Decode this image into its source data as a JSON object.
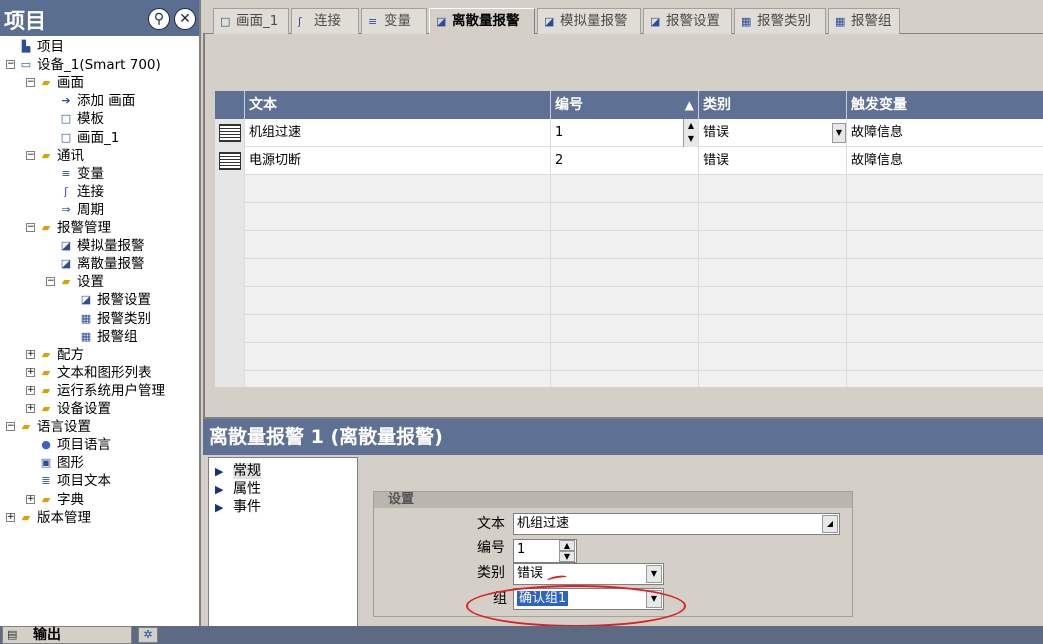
{
  "project": {
    "title": "项目",
    "tree": [
      {
        "label": "项目",
        "icon": "project-icon",
        "level": 0,
        "expander": ""
      },
      {
        "label": "设备_1(Smart 700)",
        "icon": "device-icon",
        "level": 0,
        "expander": "−"
      },
      {
        "label": "画面",
        "icon": "folder-icon",
        "level": 1,
        "expander": "−"
      },
      {
        "label": "添加 画面",
        "icon": "add-screen-icon",
        "level": 2,
        "expander": ""
      },
      {
        "label": "模板",
        "icon": "template-icon",
        "level": 2,
        "expander": ""
      },
      {
        "label": "画面_1",
        "icon": "screen-icon",
        "level": 2,
        "expander": ""
      },
      {
        "label": "通讯",
        "icon": "folder-icon",
        "level": 1,
        "expander": "−"
      },
      {
        "label": "变量",
        "icon": "tags-icon",
        "level": 2,
        "expander": ""
      },
      {
        "label": "连接",
        "icon": "connection-icon",
        "level": 2,
        "expander": ""
      },
      {
        "label": "周期",
        "icon": "cycle-icon",
        "level": 2,
        "expander": ""
      },
      {
        "label": "报警管理",
        "icon": "folder-icon",
        "level": 1,
        "expander": "−"
      },
      {
        "label": "模拟量报警",
        "icon": "analog-alarm-icon",
        "level": 2,
        "expander": ""
      },
      {
        "label": "离散量报警",
        "icon": "discrete-alarm-icon",
        "level": 2,
        "expander": ""
      },
      {
        "label": "设置",
        "icon": "folder-settings-icon",
        "level": 2,
        "expander": "−"
      },
      {
        "label": "报警设置",
        "icon": "alarm-settings-icon",
        "level": 3,
        "expander": ""
      },
      {
        "label": "报警类别",
        "icon": "alarm-classes-icon",
        "level": 3,
        "expander": ""
      },
      {
        "label": "报警组",
        "icon": "alarm-groups-icon",
        "level": 3,
        "expander": ""
      },
      {
        "label": "配方",
        "icon": "folder-icon",
        "level": 1,
        "expander": "+"
      },
      {
        "label": "文本和图形列表",
        "icon": "folder-icon",
        "level": 1,
        "expander": "+"
      },
      {
        "label": "运行系统用户管理",
        "icon": "folder-icon",
        "level": 1,
        "expander": "+"
      },
      {
        "label": "设备设置",
        "icon": "folder-icon",
        "level": 1,
        "expander": "+"
      },
      {
        "label": "语言设置",
        "icon": "folder-language-icon",
        "level": 0,
        "expander": "−"
      },
      {
        "label": "项目语言",
        "icon": "globe-icon",
        "level": 1,
        "expander": ""
      },
      {
        "label": "图形",
        "icon": "graphics-icon",
        "level": 1,
        "expander": ""
      },
      {
        "label": "项目文本",
        "icon": "text-icon",
        "level": 1,
        "expander": ""
      },
      {
        "label": "字典",
        "icon": "folder-icon",
        "level": 1,
        "expander": "+"
      },
      {
        "label": "版本管理",
        "icon": "folder-icon",
        "level": 0,
        "expander": "+"
      }
    ]
  },
  "tabs": [
    {
      "label": "画面_1",
      "icon": "screen-icon",
      "active": false
    },
    {
      "label": "连接",
      "icon": "connection-icon",
      "active": false
    },
    {
      "label": "变量",
      "icon": "tags-icon",
      "active": false
    },
    {
      "label": "离散量报警",
      "icon": "discrete-alarm-icon",
      "active": true
    },
    {
      "label": "模拟量报警",
      "icon": "analog-alarm-icon",
      "active": false
    },
    {
      "label": "报警设置",
      "icon": "alarm-settings-icon",
      "active": false
    },
    {
      "label": "报警类别",
      "icon": "alarm-classes-icon",
      "active": false
    },
    {
      "label": "报警组",
      "icon": "alarm-groups-icon",
      "active": false
    }
  ],
  "grid": {
    "columns": [
      "文本",
      "编号",
      "类别",
      "触发变量"
    ],
    "rows": [
      {
        "text": "机组过速",
        "number": "1",
        "class": "错误",
        "trigger": "故障信息"
      },
      {
        "text": "电源切断",
        "number": "2",
        "class": "错误",
        "trigger": "故障信息"
      }
    ]
  },
  "properties": {
    "title": "离散量报警 1 (离散量报警)",
    "nav": [
      {
        "label": "常规",
        "selected": true
      },
      {
        "label": "属性",
        "selected": false
      },
      {
        "label": "事件",
        "selected": false
      }
    ],
    "section_title": "设置",
    "fields": {
      "text_label": "文本",
      "text_value": "机组过速",
      "number_label": "编号",
      "number_value": "1",
      "class_label": "类别",
      "class_value": "错误",
      "group_label": "组",
      "group_value": "确认组1"
    }
  },
  "output": {
    "label": "输出"
  },
  "colors": {
    "header_blue": "#5e7093",
    "panel_gray": "#d4d0c8",
    "highlight": "#2b63c4",
    "annotation_red": "#e02020"
  }
}
